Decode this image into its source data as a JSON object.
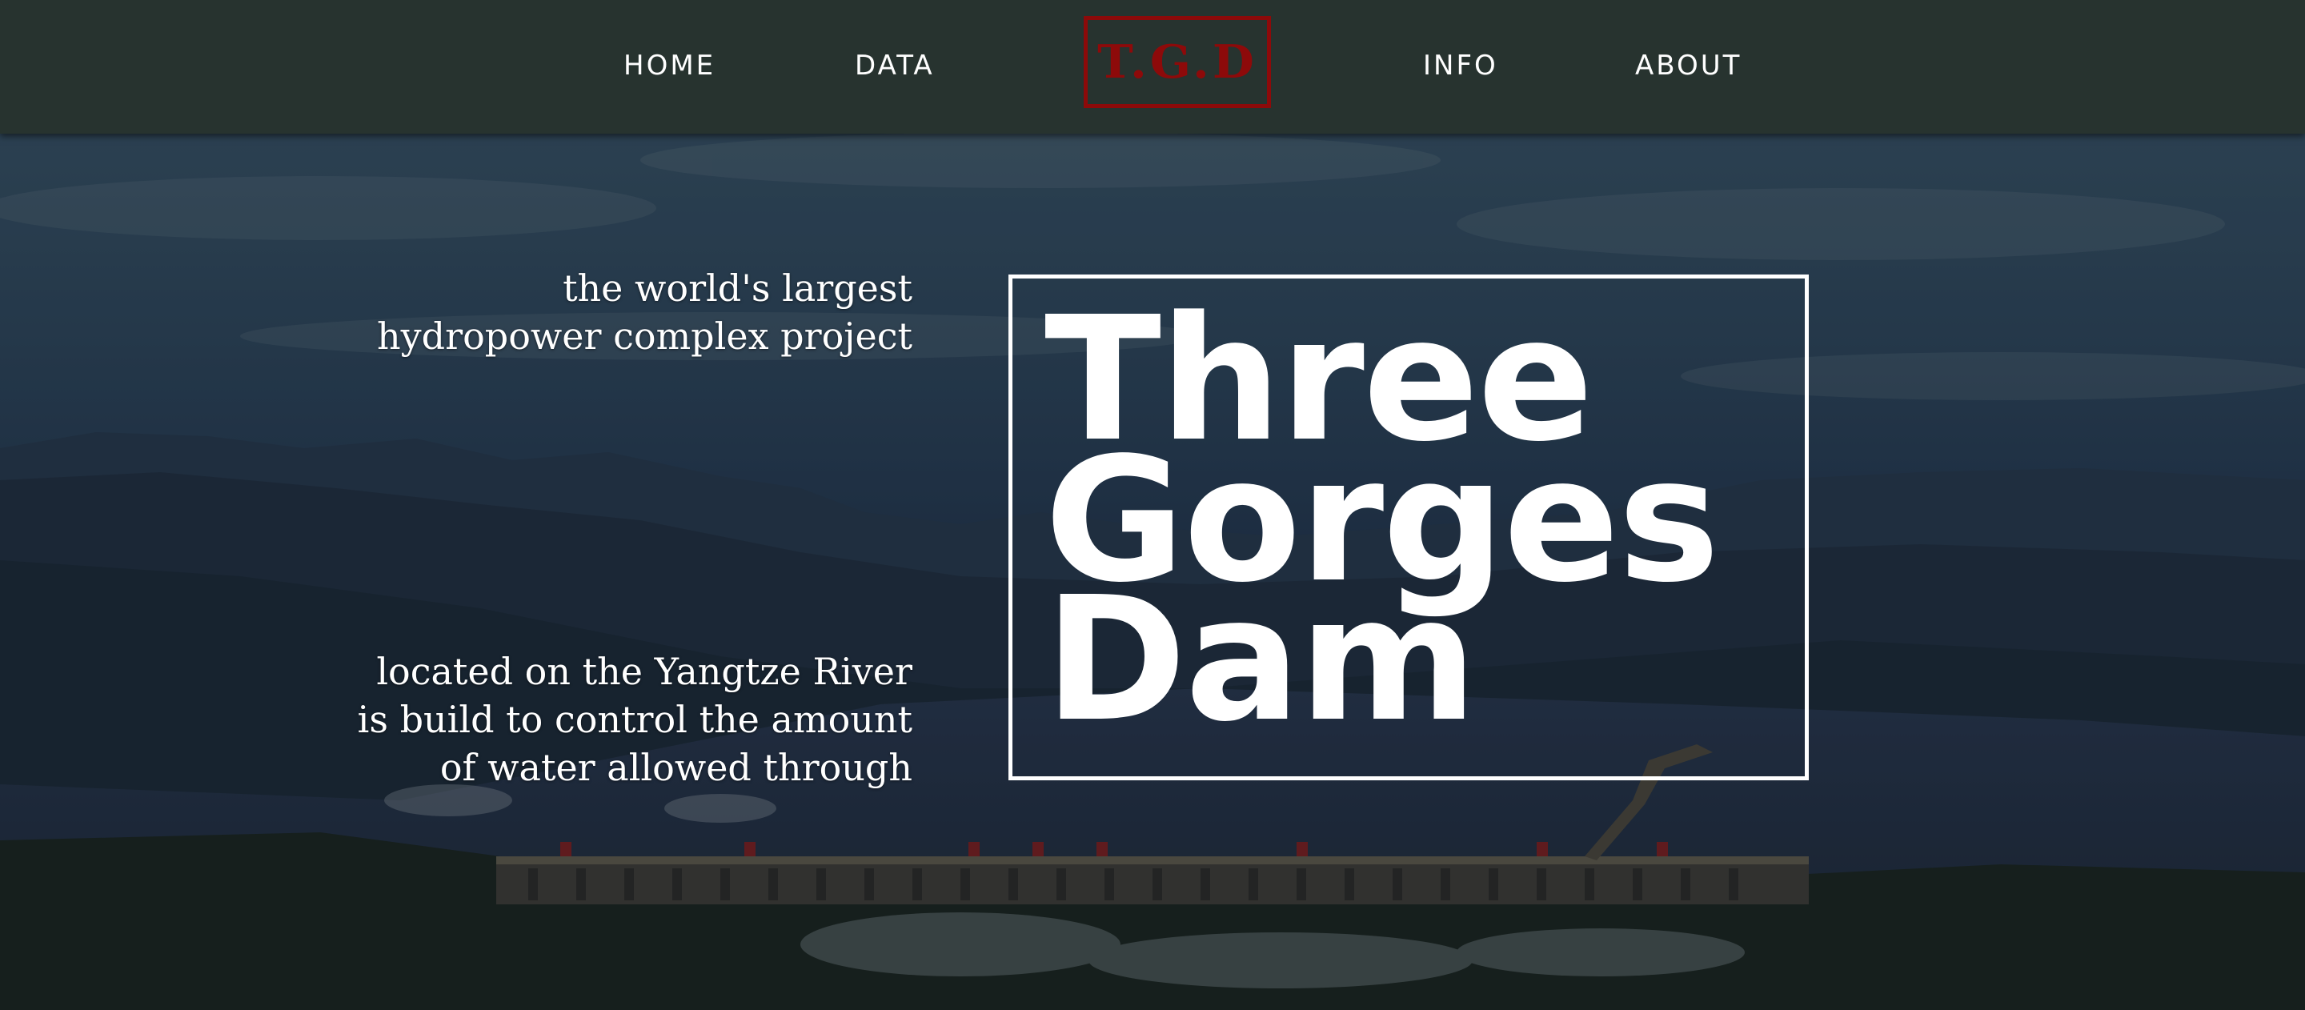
{
  "nav": {
    "items": [
      {
        "label": "HOME"
      },
      {
        "label": "DATA"
      },
      {
        "label": "INFO"
      },
      {
        "label": "ABOUT"
      }
    ],
    "logo": "T.G.D",
    "logo_color": "#8d0a0a",
    "background_color": "#27332f"
  },
  "hero": {
    "tagline_top": "the world's largest hydropower complex project",
    "tagline_bottom": "located on the Yangtze River is build to control the amount of water allowed through",
    "title_lines": [
      "Three",
      "Gorges",
      "Dam"
    ]
  }
}
